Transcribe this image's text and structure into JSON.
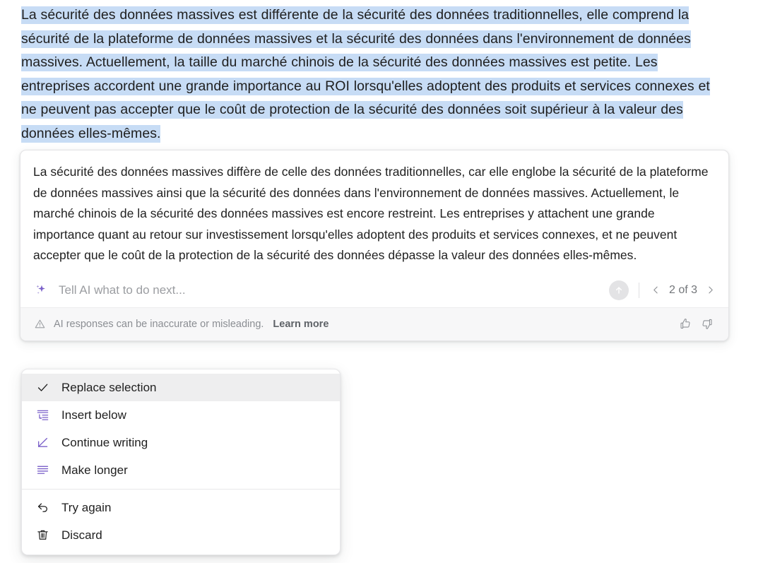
{
  "source_selection": {
    "text": "La sécurité des données massives est différente de la sécurité des données traditionnelles, elle comprend la sécurité de la plateforme de données massives et la sécurité des données dans l'environnement de données massives. Actuellement, la taille du marché chinois de la sécurité des données massives est petite. Les entreprises accordent une grande importance au ROI lorsqu'elles adoptent des produits et services connexes et ne peuvent pas accepter que le coût de protection de la sécurité des données soit supérieur à la valeur des données elles-mêmes.",
    "highlight_color": "#c7dcf5"
  },
  "ai_card": {
    "response_text": "La sécurité des données massives diffère de celle des données traditionnelles, car elle englobe la sécurité de la plateforme de données massives ainsi que la sécurité des données dans l'environnement de données massives. Actuellement, le marché chinois de la sécurité des données massives est encore restreint. Les entreprises y attachent une grande importance quant au retour sur investissement lorsqu'elles adoptent des produits et services connexes, et ne peuvent accepter que le coût de la protection de la sécurité des données dépasse la valeur des données elles-mêmes.",
    "prompt": {
      "icon": "sparkle-icon",
      "icon_color": "#7b61c9",
      "value": "",
      "placeholder": "Tell AI what to do next..."
    },
    "submit": {
      "icon": "arrow-up-icon",
      "label": "Submit",
      "background": "#e3e3e5"
    },
    "pager": {
      "prev_icon": "chevron-left-icon",
      "next_icon": "chevron-right-icon",
      "label": "2 of 3",
      "current": 2,
      "total": 3
    },
    "footer": {
      "warning_icon": "warning-triangle-icon",
      "disclaimer": "AI responses can be inaccurate or misleading.",
      "learn_more": "Learn more",
      "thumbs_up_icon": "thumbs-up-icon",
      "thumbs_down_icon": "thumbs-down-icon",
      "background": "#f7f7f8"
    }
  },
  "menu": {
    "accent_color": "#7b61c9",
    "groups": [
      {
        "items": [
          {
            "label": "Replace selection",
            "icon": "check-icon",
            "icon_color": "#1f1f1f",
            "active": true
          },
          {
            "label": "Insert below",
            "icon": "insert-below-icon",
            "icon_color": "#7b61c9",
            "active": false
          },
          {
            "label": "Continue writing",
            "icon": "pencil-icon",
            "icon_color": "#7b61c9",
            "active": false
          },
          {
            "label": "Make longer",
            "icon": "make-longer-icon",
            "icon_color": "#7b61c9",
            "active": false
          }
        ]
      },
      {
        "items": [
          {
            "label": "Try again",
            "icon": "undo-arrow-icon",
            "icon_color": "#1f1f1f",
            "active": false
          },
          {
            "label": "Discard",
            "icon": "trash-icon",
            "icon_color": "#1f1f1f",
            "active": false
          }
        ]
      }
    ]
  }
}
